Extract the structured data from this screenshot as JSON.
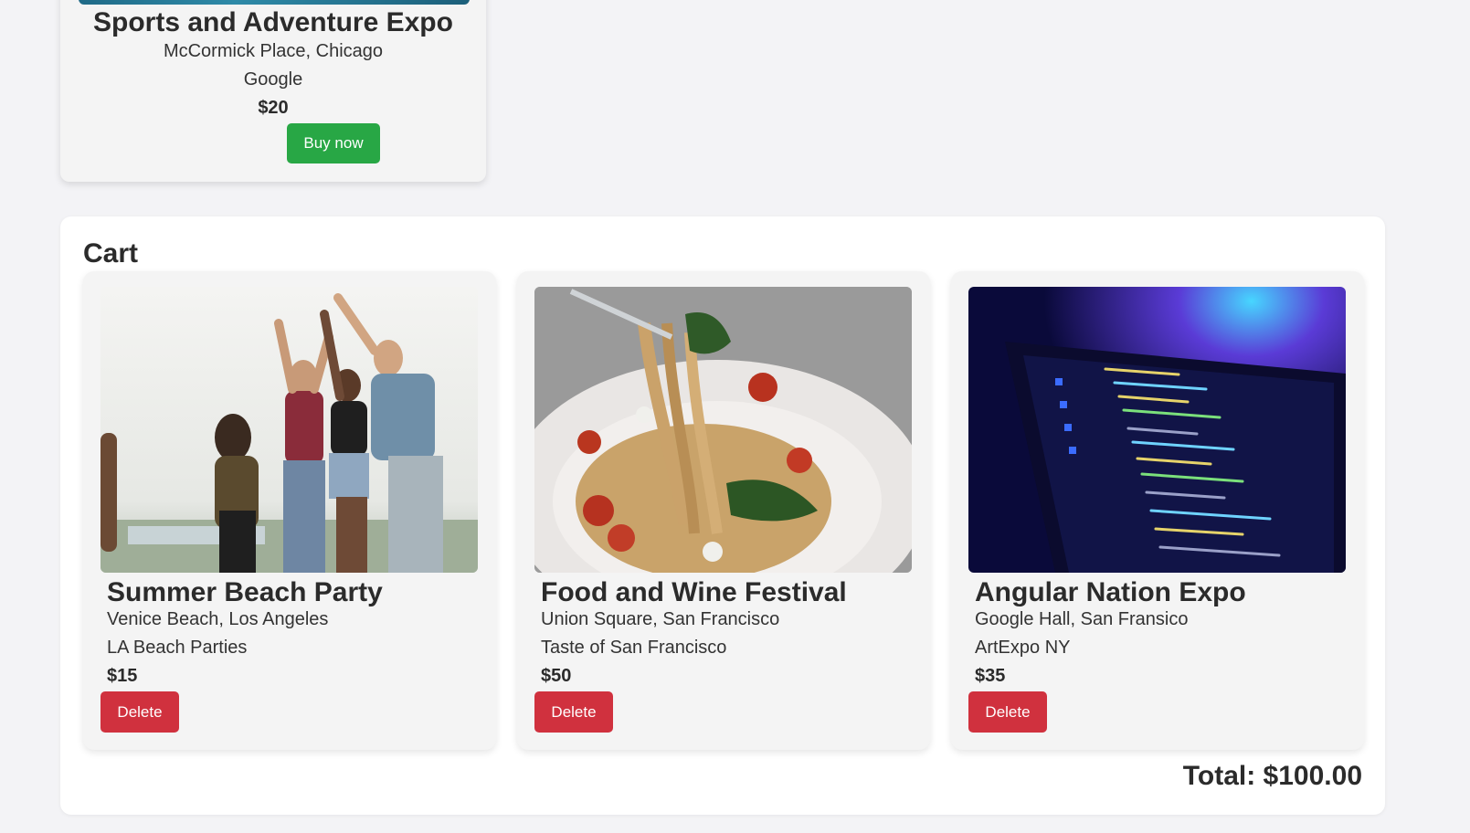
{
  "featured_event": {
    "title": "Sports and Adventure Expo",
    "venue": "McCormick Place, Chicago",
    "organizer": "Google",
    "price": "$20",
    "buy_label": "Buy now"
  },
  "cart": {
    "title": "Cart",
    "items": [
      {
        "name": "Summer Beach Party",
        "location": "Venice Beach, Los Angeles",
        "organizer": "LA Beach Parties",
        "price": "$15",
        "delete_label": "Delete",
        "image": "beach-party-photo"
      },
      {
        "name": "Food and Wine Festival",
        "location": "Union Square, San Francisco",
        "organizer": "Taste of San Francisco",
        "price": "$50",
        "delete_label": "Delete",
        "image": "pasta-dish-photo"
      },
      {
        "name": "Angular Nation Expo",
        "location": "Google Hall, San Fransico",
        "organizer": "ArtExpo NY",
        "price": "$35",
        "delete_label": "Delete",
        "image": "laptop-code-photo"
      }
    ],
    "total": "Total: $100.00"
  },
  "colors": {
    "buy": "#28a745",
    "delete": "#d0313e",
    "page_bg": "#f3f3f6",
    "card_bg": "#f4f4f4"
  }
}
